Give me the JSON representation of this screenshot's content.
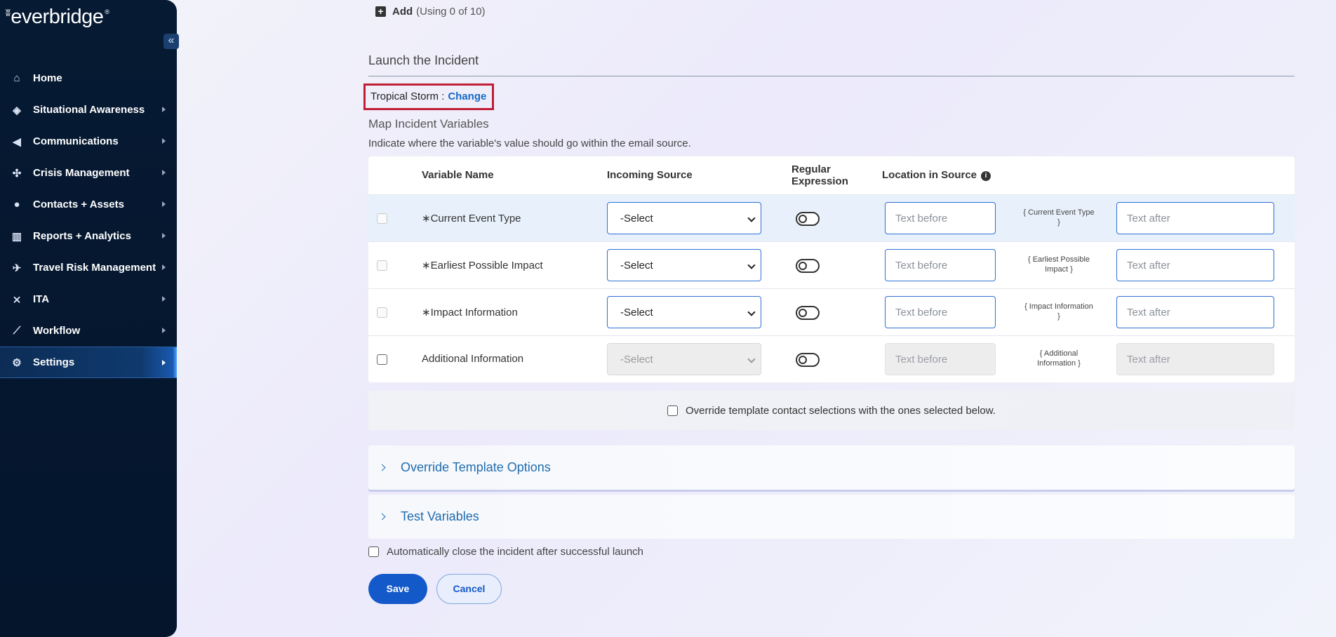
{
  "sidebar": {
    "logo_text": "everbridge",
    "collapse_icon": "«",
    "items": [
      {
        "label": "Home",
        "icon": "home-icon",
        "glyph": "⌂"
      },
      {
        "label": "Situational Awareness",
        "icon": "radar-icon",
        "glyph": "◈"
      },
      {
        "label": "Communications",
        "icon": "megaphone-icon",
        "glyph": "◀"
      },
      {
        "label": "Crisis Management",
        "icon": "network-icon",
        "glyph": "✣"
      },
      {
        "label": "Contacts + Assets",
        "icon": "location-pin-icon",
        "glyph": "●"
      },
      {
        "label": "Reports + Analytics",
        "icon": "bar-chart-icon",
        "glyph": "▥"
      },
      {
        "label": "Travel Risk Management",
        "icon": "plane-icon",
        "glyph": "✈"
      },
      {
        "label": "ITA",
        "icon": "ita-icon",
        "glyph": "⨯"
      },
      {
        "label": "Workflow",
        "icon": "line-chart-icon",
        "glyph": "⟋"
      },
      {
        "label": "Settings",
        "icon": "gear-icon",
        "glyph": "⚙"
      }
    ],
    "active_item": "Settings"
  },
  "main": {
    "add": {
      "label": "Add",
      "count": "(Using 0 of 10)"
    },
    "section_title": "Launch the Incident",
    "incident": {
      "name": "Tropical Storm :",
      "change_label": "Change"
    },
    "map_title": "Map Incident Variables",
    "map_description": "Indicate where the variable's value should go within the email source.",
    "table": {
      "headers": {
        "variable_name": "Variable Name",
        "incoming_source": "Incoming Source",
        "regular_expression_1": "Regular",
        "regular_expression_2": "Expression",
        "location_in_source": "Location in Source"
      },
      "rows": [
        {
          "name": "∗Current Event Type",
          "select": "-Select",
          "text_before": "Text before",
          "token_1": "{ Current Event Type",
          "token_2": "}",
          "text_after": "Text after"
        },
        {
          "name": "∗Earliest Possible Impact",
          "select": "-Select",
          "text_before": "Text before",
          "token_1": "{ Earliest Possible",
          "token_2": "Impact }",
          "text_after": "Text after"
        },
        {
          "name": "∗Impact Information",
          "select": "-Select",
          "text_before": "Text before",
          "token_1": "{ Impact Information",
          "token_2": "}",
          "text_after": "Text after"
        },
        {
          "name": "Additional Information",
          "select": "-Select",
          "text_before": "Text before",
          "token_1": "{ Additional",
          "token_2": "Information }",
          "text_after": "Text after"
        }
      ]
    },
    "override_contacts_label": "Override template contact selections with the ones selected below.",
    "accordions": {
      "override_template": "Override Template Options",
      "test_variables": "Test Variables"
    },
    "auto_close_label": "Automatically close the incident after successful launch",
    "buttons": {
      "save": "Save",
      "cancel": "Cancel"
    }
  },
  "colors": {
    "sidebar_bg": "#061a33",
    "accent_blue": "#1459c9",
    "highlight_border": "#c01f34",
    "link_blue": "#1769c6"
  }
}
